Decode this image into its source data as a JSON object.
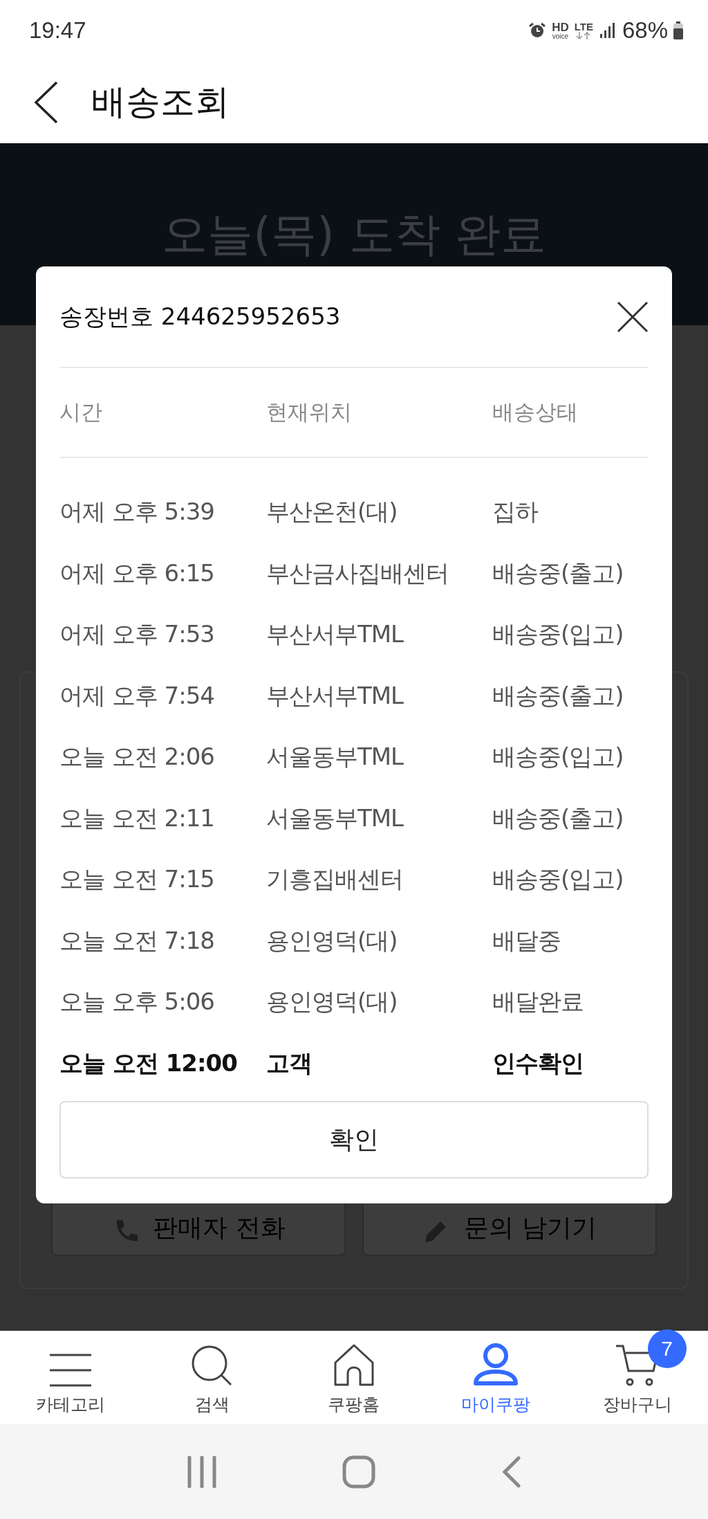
{
  "status_bar": {
    "time": "19:47",
    "hd": "HD",
    "voice": "voice",
    "lte": "LTE",
    "battery": "68%"
  },
  "app_bar": {
    "title": "배송조회"
  },
  "header": {
    "title": "오늘(목) 도착 완료"
  },
  "background_buttons": [
    {
      "label": "판매자 전화",
      "kind": "phone"
    },
    {
      "label": "문의 남기기",
      "kind": "pencil"
    }
  ],
  "dialog": {
    "title": "송장번호 244625952653",
    "columns": [
      "시간",
      "현재위치",
      "배송상태"
    ],
    "rows": [
      {
        "time": "어제 오후 5:39",
        "location": "부산온천(대)",
        "status": "집하",
        "emphasized": false
      },
      {
        "time": "어제 오후 6:15",
        "location": "부산금사집배센터",
        "status": "배송중(출고)",
        "emphasized": false
      },
      {
        "time": "어제 오후 7:53",
        "location": "부산서부TML",
        "status": "배송중(입고)",
        "emphasized": false
      },
      {
        "time": "어제 오후 7:54",
        "location": "부산서부TML",
        "status": "배송중(출고)",
        "emphasized": false
      },
      {
        "time": "오늘 오전 2:06",
        "location": "서울동부TML",
        "status": "배송중(입고)",
        "emphasized": false
      },
      {
        "time": "오늘 오전 2:11",
        "location": "서울동부TML",
        "status": "배송중(출고)",
        "emphasized": false
      },
      {
        "time": "오늘 오전 7:15",
        "location": "기흥집배센터",
        "status": "배송중(입고)",
        "emphasized": false
      },
      {
        "time": "오늘 오전 7:18",
        "location": "용인영덕(대)",
        "status": "배달중",
        "emphasized": false
      },
      {
        "time": "오늘 오후 5:06",
        "location": "용인영덕(대)",
        "status": "배달완료",
        "emphasized": false
      },
      {
        "time": "오늘 오전 12:00",
        "location": "고객",
        "status": "인수확인",
        "emphasized": true
      }
    ],
    "confirm": "확인"
  },
  "bottom_nav": [
    {
      "label": "카테고리",
      "kind": "menu",
      "selected": false
    },
    {
      "label": "검색",
      "kind": "search",
      "selected": false
    },
    {
      "label": "쿠팡홈",
      "kind": "home",
      "selected": false
    },
    {
      "label": "마이쿠팡",
      "kind": "person",
      "selected": true
    },
    {
      "label": "장바구니",
      "kind": "cart",
      "selected": false,
      "badge": "7"
    }
  ]
}
